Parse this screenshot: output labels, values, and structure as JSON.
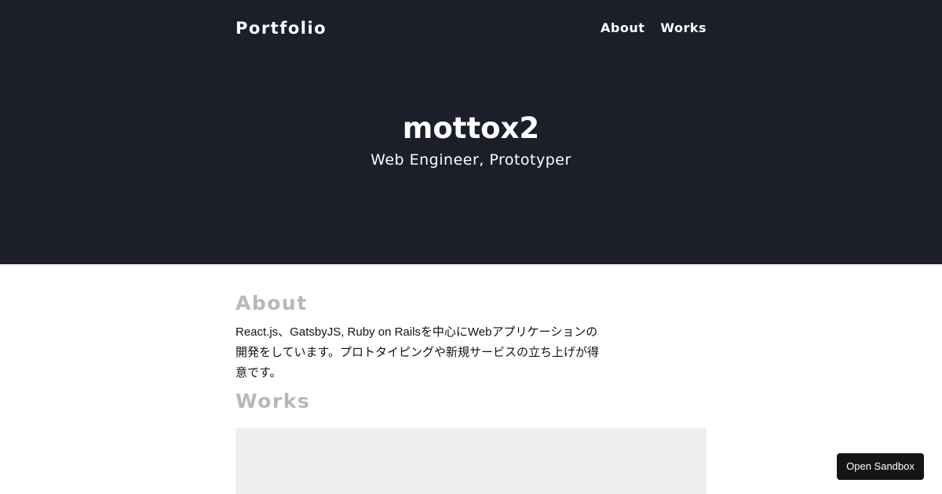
{
  "header": {
    "brand": "Portfolio",
    "nav": [
      {
        "label": "About"
      },
      {
        "label": "Works"
      }
    ]
  },
  "hero": {
    "title": "mottox2",
    "subtitle": "Web Engineer, Prototyper"
  },
  "about": {
    "heading": "About",
    "text": "React.js、GatsbyJS, Ruby on Railsを中心にWebアプリケーションの開発をしています。プロトタイピングや新規サービスの立ち上げが得意です。"
  },
  "works": {
    "heading": "Works"
  },
  "sandbox": {
    "label": "Open Sandbox"
  },
  "colors": {
    "hero_bg": "#1c1e2a",
    "heading_gray": "#b8b8b8",
    "card_bg": "#eeeeee",
    "button_bg": "#151515"
  }
}
